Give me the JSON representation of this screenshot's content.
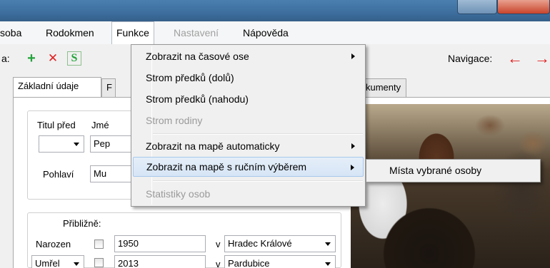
{
  "menubar": {
    "items": [
      {
        "label": "soba"
      },
      {
        "label": "Rodokmen"
      },
      {
        "label": "Funkce"
      },
      {
        "label": "Nastavení"
      },
      {
        "label": "Nápověda"
      }
    ]
  },
  "toolbar": {
    "left_label": "a:",
    "add_glyph": "+",
    "delete_glyph": "✕",
    "save_glyph": "S",
    "nav_label": "Navigace:",
    "back_glyph": "←",
    "forward_glyph": "→"
  },
  "tabs": [
    {
      "label": "Základní údaje"
    },
    {
      "label": "F"
    },
    {
      "label": "kumenty"
    }
  ],
  "form": {
    "titul_pred_label": "Titul před",
    "jmeno_label": "Jmé",
    "jmeno_value": "Pep",
    "pohlavi_label": "Pohlaví",
    "pohlavi_value": "Mu",
    "priblizne_label": "Přibližně:",
    "narozen_label": "Narozen",
    "narozen_year": "1950",
    "narozen_v": "v",
    "narozen_place": "Hradec Králové",
    "umrel_label": "Umřel",
    "umrel_year": "2013",
    "umrel_v": "v",
    "umrel_place": "Pardubice"
  },
  "menu": {
    "items": [
      {
        "label": "Zobrazit na časové ose"
      },
      {
        "label": "Strom předků (dolů)"
      },
      {
        "label": "Strom předků (nahodu)"
      },
      {
        "label": "Strom rodiny"
      },
      {
        "label": "Zobrazit na mapě automaticky"
      },
      {
        "label": "Zobrazit na mapě s ručním výběrem"
      },
      {
        "label": "Statistiky osob"
      }
    ]
  },
  "submenu": {
    "items": [
      {
        "label": "Místa vybrané osoby"
      }
    ]
  },
  "colors": {
    "titlebar": "#3d6e9e",
    "accent_green": "#22a33a",
    "accent_red": "#e02020",
    "menu_highlight": "#d6e5f6"
  }
}
